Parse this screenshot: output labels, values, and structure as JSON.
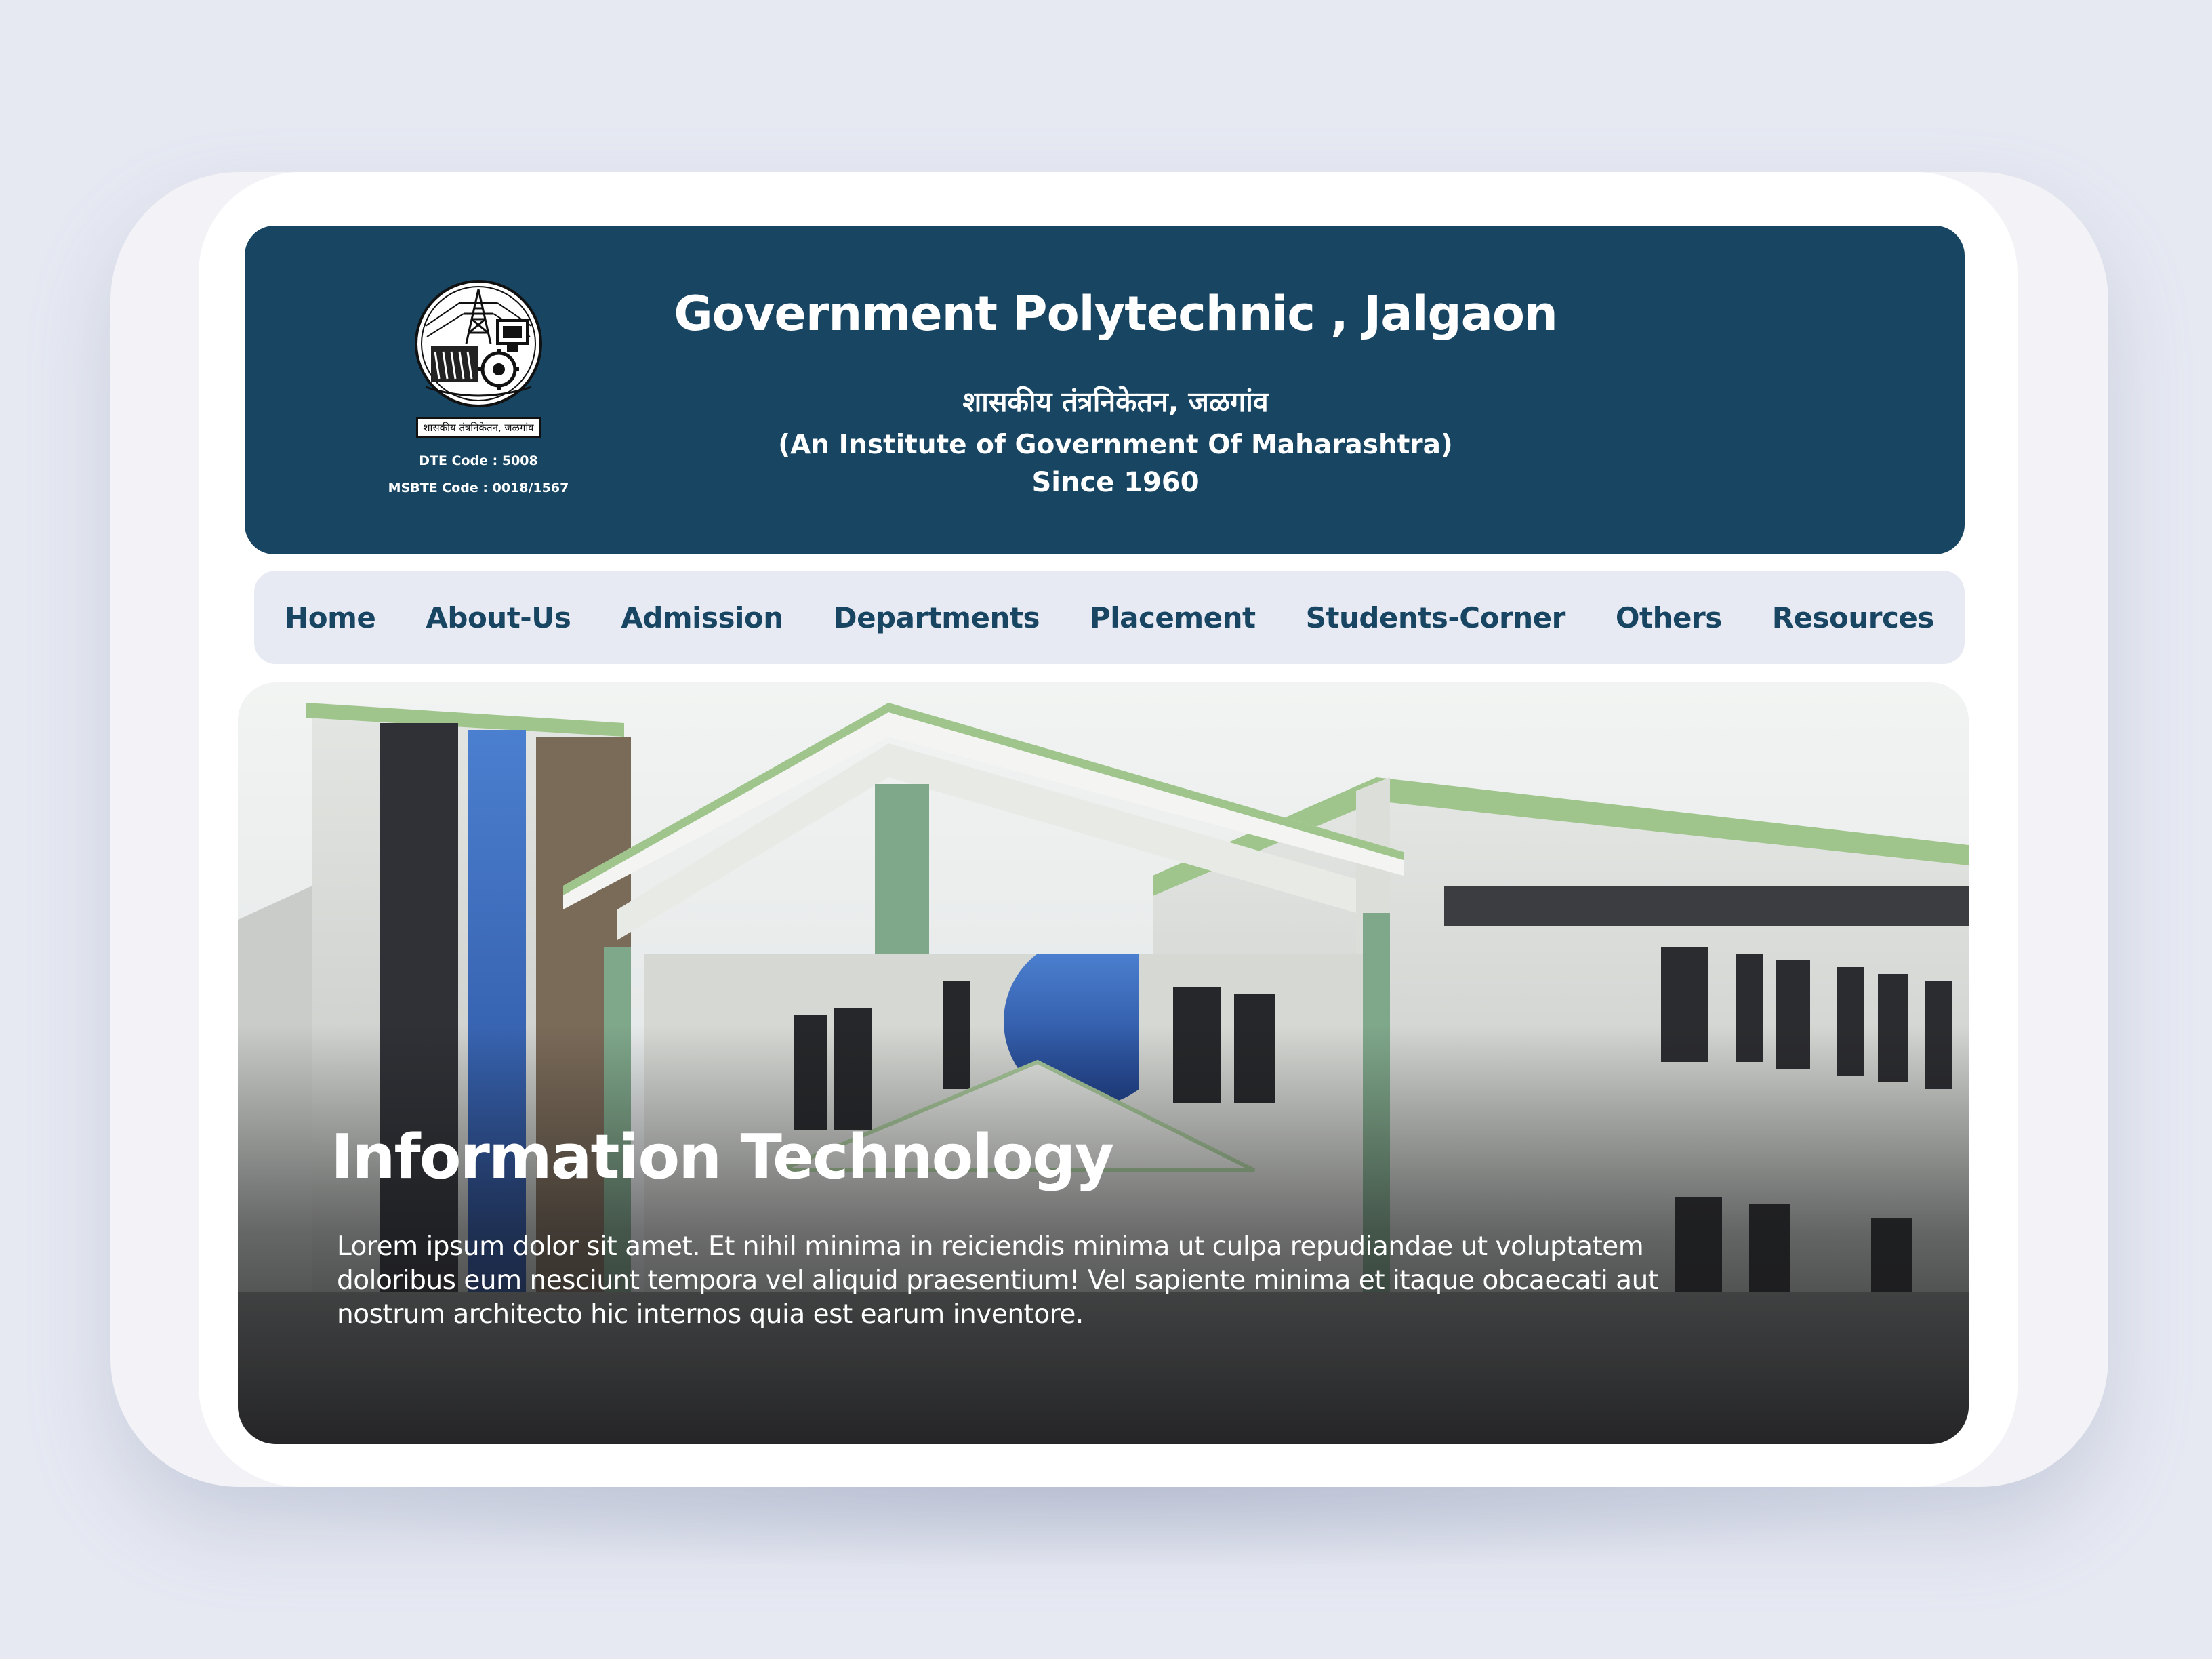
{
  "header": {
    "title": "Government Polytechnic , Jalgaon",
    "marathi_title": "शासकीय तंत्रनिकेतन, जळगांव",
    "tagline": "(An Institute of Government Of Maharashtra)",
    "since": "Since 1960",
    "logo_caption": "शासकीय तंत्रनिकेतन, जळगांव",
    "dte_code": "DTE Code : 5008",
    "msbte_code": "MSBTE Code : 0018/1567"
  },
  "nav": {
    "items": [
      {
        "label": "Home"
      },
      {
        "label": "About-Us"
      },
      {
        "label": "Admission"
      },
      {
        "label": "Departments"
      },
      {
        "label": "Placement"
      },
      {
        "label": "Students-Corner"
      },
      {
        "label": "Others"
      },
      {
        "label": "Resources"
      }
    ]
  },
  "hero": {
    "title": "Information Technology",
    "description": "Lorem ipsum dolor sit amet. Et nihil minima in reiciendis minima ut culpa repudiandae ut voluptatem doloribus eum nesciunt tempora vel aliquid praesentium! Vel sapiente minima et itaque obcaecati aut nostrum architecto hic internos quia est earum inventore."
  },
  "colors": {
    "header_bg": "#184562",
    "nav_bg": "#e7e9f3",
    "nav_text": "#184562",
    "page_bg": "#e6e9f2"
  },
  "icons": {
    "logo": "college-emblem-icon"
  }
}
